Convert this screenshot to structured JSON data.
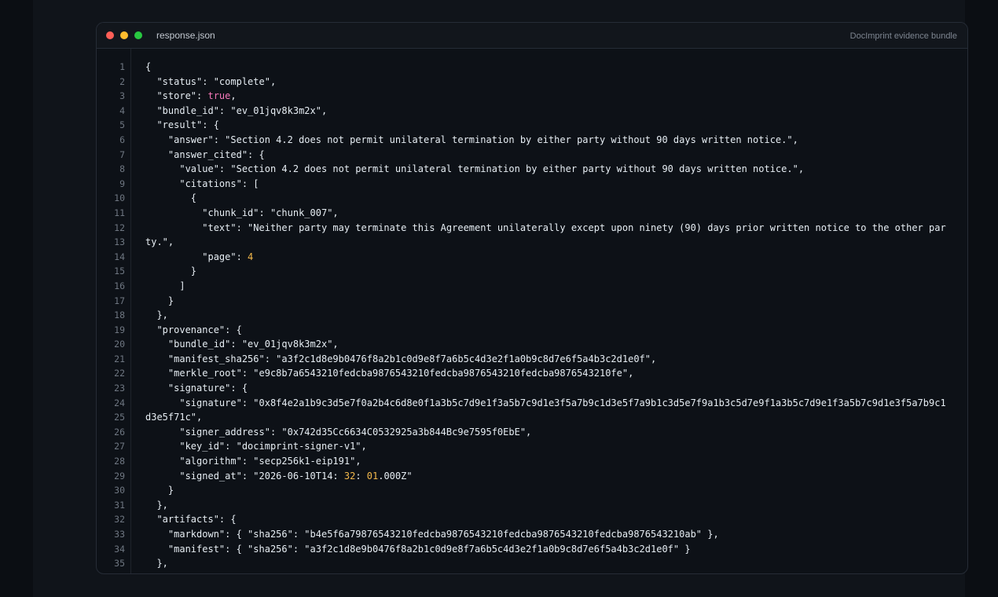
{
  "window": {
    "filename": "response.json",
    "label": "DocImprint evidence bundle"
  },
  "colors": {
    "background": "#0b0e13",
    "editor": "#0d1117",
    "text": "#e6edf3",
    "boolean": "#f778ba",
    "number": "#f2b84b",
    "line_number": "#6e7681"
  },
  "code": {
    "line_numbers": [
      "1",
      "2",
      "3",
      "4",
      "5",
      "6",
      "7",
      "8",
      "9",
      "10",
      "11",
      "12",
      "13",
      "14",
      "15",
      "16",
      "17",
      "18",
      "19",
      "20",
      "21",
      "22",
      "23",
      "24",
      "25",
      "26",
      "27",
      "28",
      "29",
      "30",
      "31",
      "32",
      "33",
      "34",
      "35"
    ],
    "lines": [
      [
        {
          "t": "{"
        }
      ],
      [
        {
          "t": "  \"status\": \"complete\","
        }
      ],
      [
        {
          "t": "  \"store\": "
        },
        {
          "t": "true",
          "c": "kw"
        },
        {
          "t": ","
        }
      ],
      [
        {
          "t": "  \"bundle_id\": \"ev_01jqv8k3m2x\","
        }
      ],
      [
        {
          "t": "  \"result\": {"
        }
      ],
      [
        {
          "t": "    \"answer\": \"Section 4.2 does not permit unilateral termination by either party without 90 days written notice.\","
        }
      ],
      [
        {
          "t": "    \"answer_cited\": {"
        }
      ],
      [
        {
          "t": "      \"value\": \"Section 4.2 does not permit unilateral termination by either party without 90 days written notice.\","
        }
      ],
      [
        {
          "t": "      \"citations\": ["
        }
      ],
      [
        {
          "t": "        {"
        }
      ],
      [
        {
          "t": "          \"chunk_id\": \"chunk_007\","
        }
      ],
      [
        {
          "t": "          \"text\": \"Neither party may terminate this Agreement unilaterally except upon ninety (90) days prior written notice to the other par"
        }
      ],
      [
        {
          "t": "ty.\","
        }
      ],
      [
        {
          "t": "          \"page\": "
        },
        {
          "t": "4",
          "c": "num"
        }
      ],
      [
        {
          "t": "        }"
        }
      ],
      [
        {
          "t": "      ]"
        }
      ],
      [
        {
          "t": "    }"
        }
      ],
      [
        {
          "t": "  },"
        }
      ],
      [
        {
          "t": "  \"provenance\": {"
        }
      ],
      [
        {
          "t": "    \"bundle_id\": \"ev_01jqv8k3m2x\","
        }
      ],
      [
        {
          "t": "    \"manifest_sha256\": \"a3f2c1d8e9b0476f8a2b1c0d9e8f7a6b5c4d3e2f1a0b9c8d7e6f5a4b3c2d1e0f\","
        }
      ],
      [
        {
          "t": "    \"merkle_root\": \"e9c8b7a6543210fedcba9876543210fedcba9876543210fedcba9876543210fe\","
        }
      ],
      [
        {
          "t": "    \"signature\": {"
        }
      ],
      [
        {
          "t": "      \"signature\": \"0x8f4e2a1b9c3d5e7f0a2b4c6d8e0f1a3b5c7d9e1f3a5b7c9d1e3f5a7b9c1d3e5f7a9b1c3d5e7f9a1b3c5d7e9f1a3b5c7d9e1f3a5b7c9d1e3f5a7b9c1"
        }
      ],
      [
        {
          "t": "d3e5f71c\","
        }
      ],
      [
        {
          "t": "      \"signer_address\": \"0x742d35Cc6634C0532925a3b844Bc9e7595f0EbE\","
        }
      ],
      [
        {
          "t": "      \"key_id\": \"docimprint-signer-v1\","
        }
      ],
      [
        {
          "t": "      \"algorithm\": \"secp256k1-eip191\","
        }
      ],
      [
        {
          "t": "      \"signed_at\": \"2026-06-10T14: "
        },
        {
          "t": "32",
          "c": "num"
        },
        {
          "t": ": "
        },
        {
          "t": "01",
          "c": "num"
        },
        {
          "t": ".000Z\""
        }
      ],
      [
        {
          "t": "    }"
        }
      ],
      [
        {
          "t": "  },"
        }
      ],
      [
        {
          "t": "  \"artifacts\": {"
        }
      ],
      [
        {
          "t": "    \"markdown\": { \"sha256\": \"b4e5f6a79876543210fedcba9876543210fedcba9876543210fedcba9876543210ab\" },"
        }
      ],
      [
        {
          "t": "    \"manifest\": { \"sha256\": \"a3f2c1d8e9b0476f8a2b1c0d9e8f7a6b5c4d3e2f1a0b9c8d7e6f5a4b3c2d1e0f\" }"
        }
      ],
      [
        {
          "t": "  },"
        }
      ]
    ]
  }
}
